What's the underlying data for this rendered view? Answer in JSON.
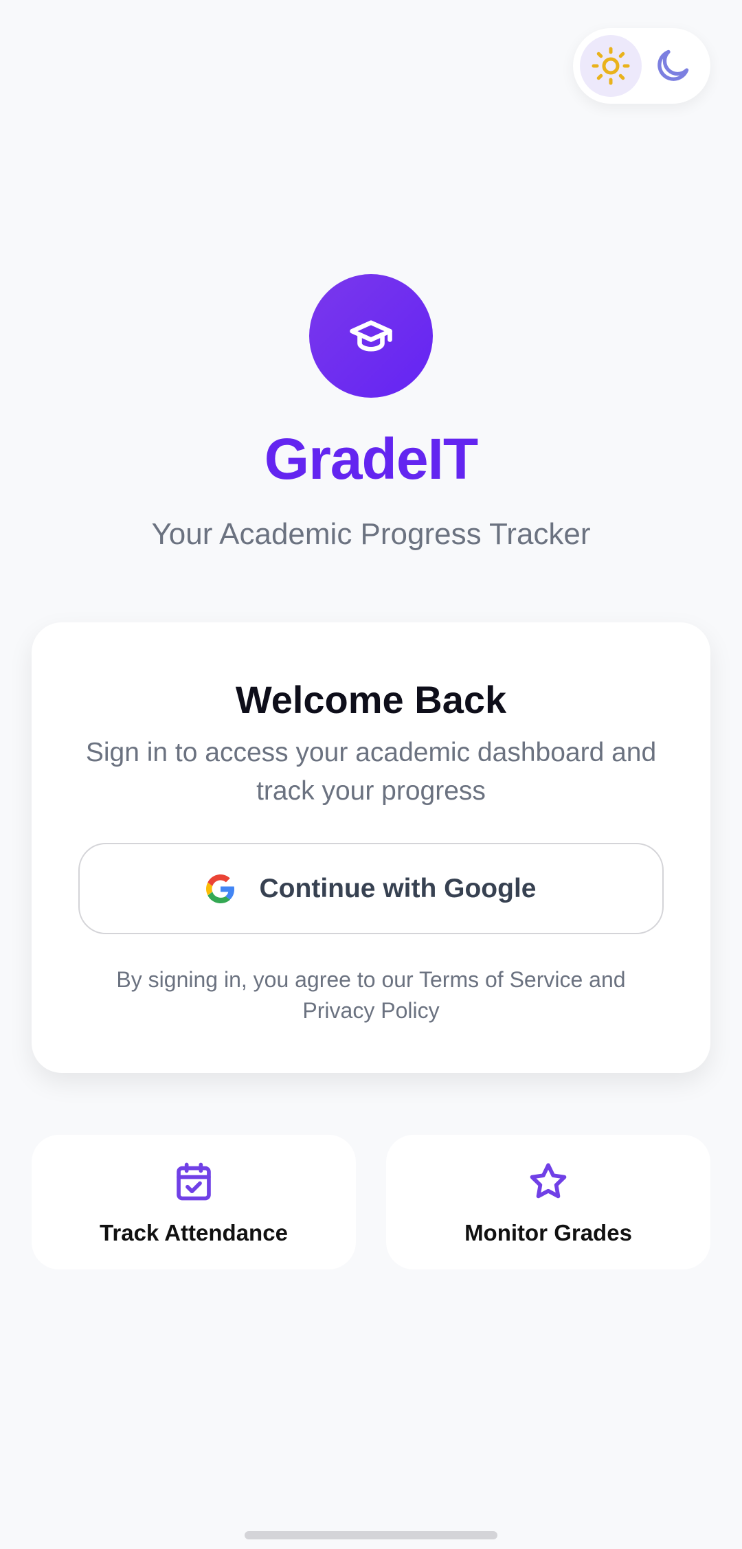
{
  "theme_toggle": {
    "light_icon": "sun-icon",
    "dark_icon": "moon-icon",
    "selected": "light"
  },
  "app": {
    "logo_icon": "graduation-cap-icon",
    "title": "GradeIT",
    "subtitle": "Your Academic Progress Tracker"
  },
  "signin_card": {
    "title": "Welcome Back",
    "description": "Sign in to access your academic dashboard and track your progress",
    "google_button_label": "Continue with Google",
    "google_icon": "google-icon",
    "terms": "By signing in, you agree to our Terms of Service and Privacy Policy"
  },
  "features": [
    {
      "icon": "calendar-check-icon",
      "label": "Track Attendance"
    },
    {
      "icon": "star-icon",
      "label": "Monitor Grades"
    }
  ],
  "colors": {
    "accent": "#6325f0",
    "background": "#f8f9fb",
    "sun": "#e9b21c",
    "moon": "#7c7fe0",
    "feature_icon": "#7040e6"
  }
}
